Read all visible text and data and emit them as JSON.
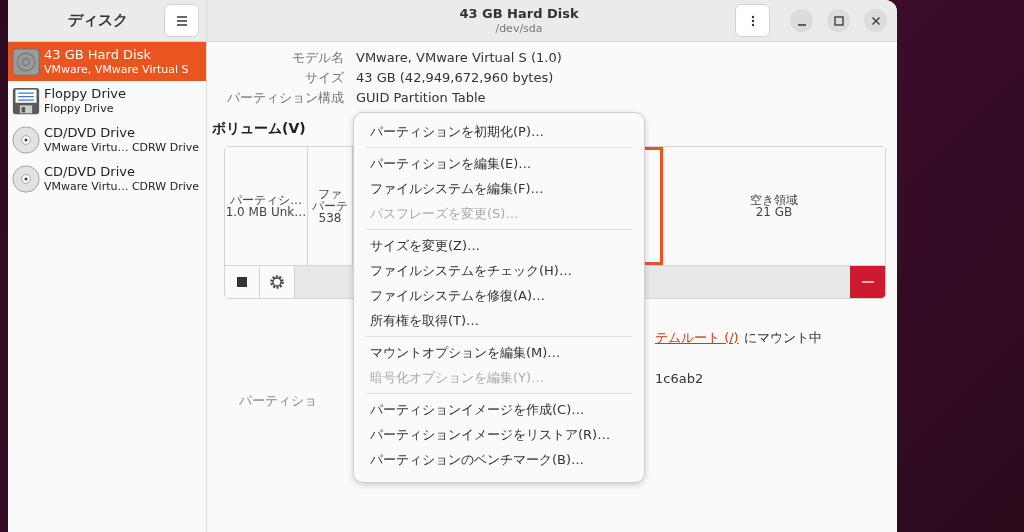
{
  "sidebar": {
    "title": "ディスク",
    "items": [
      {
        "kind": "harddisk",
        "title": "43 GB Hard Disk",
        "subtitle": "VMware, VMware Virtual S",
        "selected": true
      },
      {
        "kind": "floppy",
        "title": "Floppy Drive",
        "subtitle": "Floppy Drive",
        "selected": false
      },
      {
        "kind": "optical",
        "title": "CD/DVD Drive",
        "subtitle": "VMware Virtu… CDRW Drive",
        "selected": false
      },
      {
        "kind": "optical",
        "title": "CD/DVD Drive",
        "subtitle": "VMware Virtu… CDRW Drive",
        "selected": false
      }
    ]
  },
  "window": {
    "title": "43 GB Hard Disk",
    "subtitle": "/dev/sda"
  },
  "disk_info": [
    {
      "label": "モデル名",
      "value": "VMware, VMware Virtual S (1.0)"
    },
    {
      "label": "サイズ",
      "value": "43 GB (42,949,672,960 bytes)"
    },
    {
      "label": "パーティション構成",
      "value": "GUID Partition Table"
    }
  ],
  "volumes": {
    "heading": "ボリューム(V)",
    "partitions": [
      {
        "lines": [
          "パーティシ…",
          "1.0 MB Unk…"
        ],
        "selected": false
      },
      {
        "lines": [
          "ファ",
          "パーテ",
          "538"
        ],
        "selected": false
      },
      {
        "selected": true
      },
      {
        "lines": [
          "空き領域",
          "21 GB"
        ],
        "selected": false
      }
    ]
  },
  "details": [
    {
      "kind": "link",
      "value": "テムルート (/)",
      "suffix": "にマウント中"
    },
    {
      "kind": "text",
      "value": "1c6ab2"
    },
    {
      "label": "パーティショ"
    }
  ],
  "menu": [
    [
      {
        "label": "パーティションを初期化(P)…",
        "disabled": false
      }
    ],
    [
      {
        "label": "パーティションを編集(E)…",
        "disabled": false
      },
      {
        "label": "ファイルシステムを編集(F)…",
        "disabled": false
      },
      {
        "label": "パスフレーズを変更(S)…",
        "disabled": true
      }
    ],
    [
      {
        "label": "サイズを変更(Z)…",
        "disabled": false
      },
      {
        "label": "ファイルシステムをチェック(H)…",
        "disabled": false
      },
      {
        "label": "ファイルシステムを修復(A)…",
        "disabled": false
      },
      {
        "label": "所有権を取得(T)…",
        "disabled": false
      }
    ],
    [
      {
        "label": "マウントオプションを編集(M)…",
        "disabled": false
      },
      {
        "label": "暗号化オプションを編集(Y)…",
        "disabled": true
      }
    ],
    [
      {
        "label": "パーティションイメージを作成(C)…",
        "disabled": false
      },
      {
        "label": "パーティションイメージをリストア(R)…",
        "disabled": false
      },
      {
        "label": "パーティションのベンチマーク(B)…",
        "disabled": false
      }
    ]
  ]
}
